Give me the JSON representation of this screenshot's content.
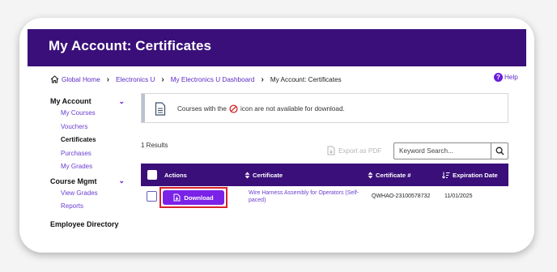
{
  "header": {
    "title": "My Account: Certificates"
  },
  "breadcrumb": {
    "items": [
      "Global Home",
      "Electronics U",
      "My Electronics U Dashboard"
    ],
    "current": "My Account: Certificates"
  },
  "help": {
    "label": "Help"
  },
  "sidebar": {
    "sections": [
      {
        "title": "My Account",
        "items": [
          "My Courses",
          "Vouchers",
          "Certificates",
          "Purchases",
          "My Grades"
        ],
        "active": "Certificates"
      },
      {
        "title": "Course Mgmt",
        "items": [
          "View Grades",
          "Reports"
        ]
      }
    ],
    "employee_directory": "Employee Directory"
  },
  "notice": {
    "text_before": "Courses with the",
    "text_after": "icon are not available for download."
  },
  "results": {
    "count_label": "1 Results"
  },
  "export": {
    "label": "Export as PDF"
  },
  "search": {
    "placeholder": "Keyword Search..."
  },
  "table": {
    "headers": [
      "Actions",
      "Certificate",
      "Certificate #",
      "Expiration Date"
    ],
    "rows": [
      {
        "action": "Download",
        "certificate": "Wire Harness Assembly for Operators (Self-paced)",
        "number": "QWHAO-23100578732",
        "expiration": "11/01/2025"
      }
    ]
  },
  "colors": {
    "header": "#3a0f7a",
    "accent": "#7a22e8",
    "link": "#6b3fd0",
    "highlight": "#d8232a"
  }
}
